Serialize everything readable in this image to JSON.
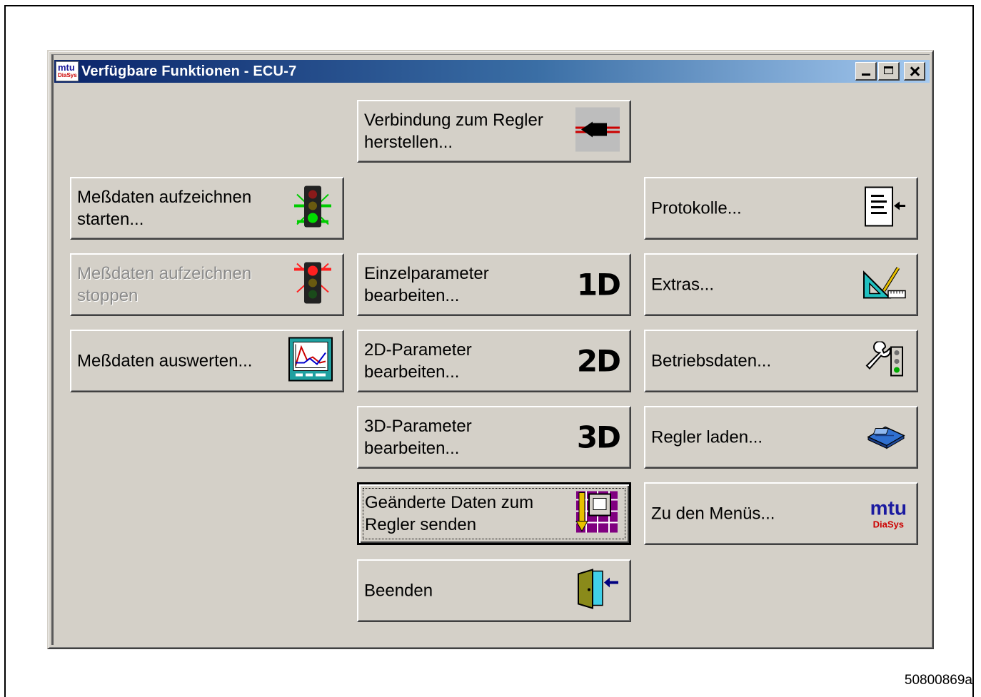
{
  "window": {
    "title": "Verfügbare Funktionen - ECU-7",
    "app_icon_text": "mtu",
    "app_icon_subtext": "DiaSys"
  },
  "buttons": {
    "connect": "Verbindung zum Regler\nherstellen...",
    "record_start": "Meßdaten aufzeichnen\nstarten...",
    "protocols": "Protokolle...",
    "record_stop": "Meßdaten aufzeichnen\nstoppen",
    "param_1d": "Einzelparameter\nbearbeiten...",
    "param_1d_badge": "1D",
    "extras": "Extras...",
    "evaluate": "Meßdaten auswerten...",
    "param_2d": "2D-Parameter\nbearbeiten...",
    "param_2d_badge": "2D",
    "operating_data": "Betriebsdaten...",
    "param_3d": "3D-Parameter\nbearbeiten...",
    "param_3d_badge": "3D",
    "load_controller": "Regler laden...",
    "send_changes": "Geänderte Daten zum\nRegler senden",
    "menus": "Zu den Menüs...",
    "menus_logo_main": "mtu",
    "menus_logo_sub": "DiaSys",
    "exit": "Beenden"
  },
  "record_stop_disabled": true,
  "focused_button": "send_changes",
  "document_id": "50800869a",
  "colors": {
    "dialog_face": "#d4d0c8",
    "title_start": "#0a246a",
    "title_end": "#a6caf0",
    "mtu_blue": "#1a1aa0",
    "diasys_red": "#cc0000"
  }
}
